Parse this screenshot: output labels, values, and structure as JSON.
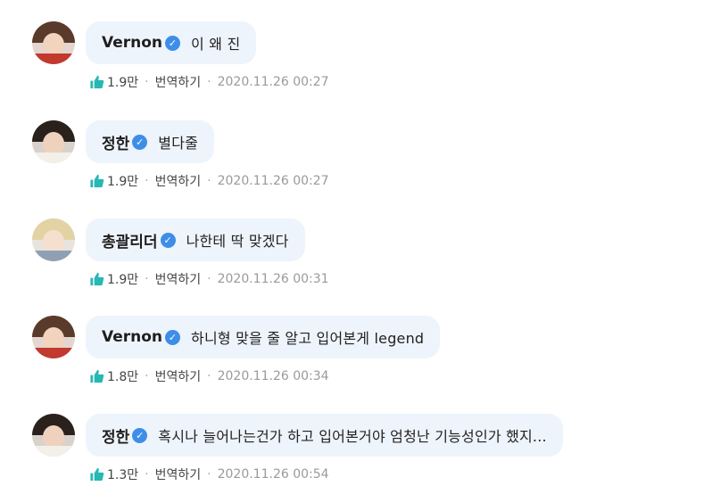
{
  "comments": [
    {
      "author": "Vernon",
      "text": "이 왜 진",
      "likes": "1.9만",
      "translate_label": "번역하기",
      "timestamp": "2020.11.26 00:27",
      "avatar": {
        "hair": "#5a3a2a",
        "face": "#f2d3bd",
        "shirt": "#c2392f",
        "bg": "#e4d6cf"
      }
    },
    {
      "author": "정한",
      "text": "별다줄",
      "likes": "1.9만",
      "translate_label": "번역하기",
      "timestamp": "2020.11.26 00:27",
      "avatar": {
        "hair": "#2b211c",
        "face": "#efd2be",
        "shirt": "#f3efe9",
        "bg": "#d9d2cc"
      }
    },
    {
      "author": "총괄리더",
      "text": "나한테 딱 맞겠다",
      "likes": "1.9만",
      "translate_label": "번역하기",
      "timestamp": "2020.11.26 00:31",
      "avatar": {
        "hair": "#e3d3a4",
        "face": "#f5e0cf",
        "shirt": "#8fa0b4",
        "bg": "#e8e4dd"
      }
    },
    {
      "author": "Vernon",
      "text": "하니형 맞을 줄 알고 입어본게 legend",
      "likes": "1.8만",
      "translate_label": "번역하기",
      "timestamp": "2020.11.26 00:34",
      "avatar": {
        "hair": "#5a3a2a",
        "face": "#f2d3bd",
        "shirt": "#c2392f",
        "bg": "#e4d6cf"
      }
    },
    {
      "author": "정한",
      "text": "혹시나 늘어나는건가 하고 입어본거야 엄청난 기능성인가 했지...",
      "likes": "1.3만",
      "translate_label": "번역하기",
      "timestamp": "2020.11.26 00:54",
      "avatar": {
        "hair": "#2b211c",
        "face": "#efd2be",
        "shirt": "#f3efe9",
        "bg": "#d9d2cc"
      }
    }
  ],
  "colors": {
    "bubble_bg": "#eef4fb",
    "verified_badge": "#3e8ee8",
    "like_icon": "#27b8b4",
    "timestamp": "#9a9a9a"
  },
  "icons": {
    "verified": "verified-badge-icon",
    "like": "thumbs-up-icon"
  }
}
